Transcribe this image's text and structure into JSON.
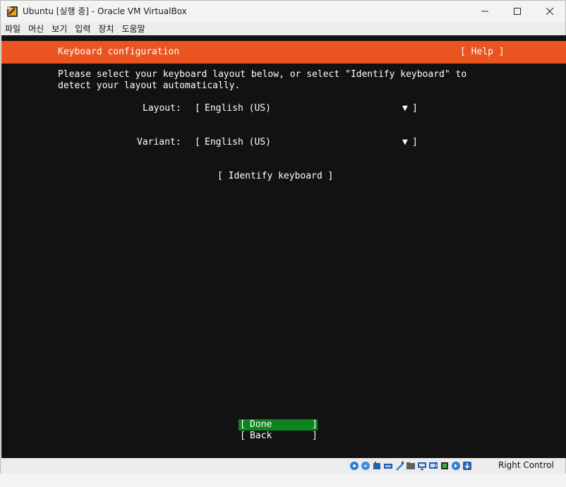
{
  "window": {
    "title": "Ubuntu [실행 중] - Oracle VM VirtualBox"
  },
  "menubar": {
    "items": [
      {
        "label": "파일"
      },
      {
        "label": "머신"
      },
      {
        "label": "보기"
      },
      {
        "label": "입력"
      },
      {
        "label": "장치"
      },
      {
        "label": "도움말"
      }
    ]
  },
  "screen": {
    "header": {
      "title": "Keyboard configuration",
      "help": "[ Help ]"
    },
    "intro_line1": "Please select your keyboard layout below, or select \"Identify keyboard\" to",
    "intro_line2": "detect your layout automatically.",
    "layout": {
      "label": "Layout:",
      "open": "[",
      "value": "English (US)",
      "arrow": "▼",
      "close": "]"
    },
    "variant": {
      "label": "Variant:",
      "open": "[",
      "value": "English (US)",
      "arrow": "▼",
      "close": "]"
    },
    "identify_button": "[ Identify keyboard ]",
    "done_button": {
      "open": "[",
      "label": "Done",
      "close": "]"
    },
    "back_button": {
      "open": "[",
      "label": "Back",
      "close": "]"
    },
    "colors": {
      "background": "#121212",
      "header": "#e95420",
      "selected": "#0e8420"
    }
  },
  "statusbar": {
    "icons": [
      "hard-disk-icon",
      "optical-drive-icon",
      "audio-icon",
      "network-icon",
      "usb-icon",
      "shared-folders-icon",
      "display-icon",
      "recording-icon",
      "cpu-icon",
      "mouse-integration-icon",
      "keyboard-icon"
    ],
    "host_key": "Right Control"
  }
}
